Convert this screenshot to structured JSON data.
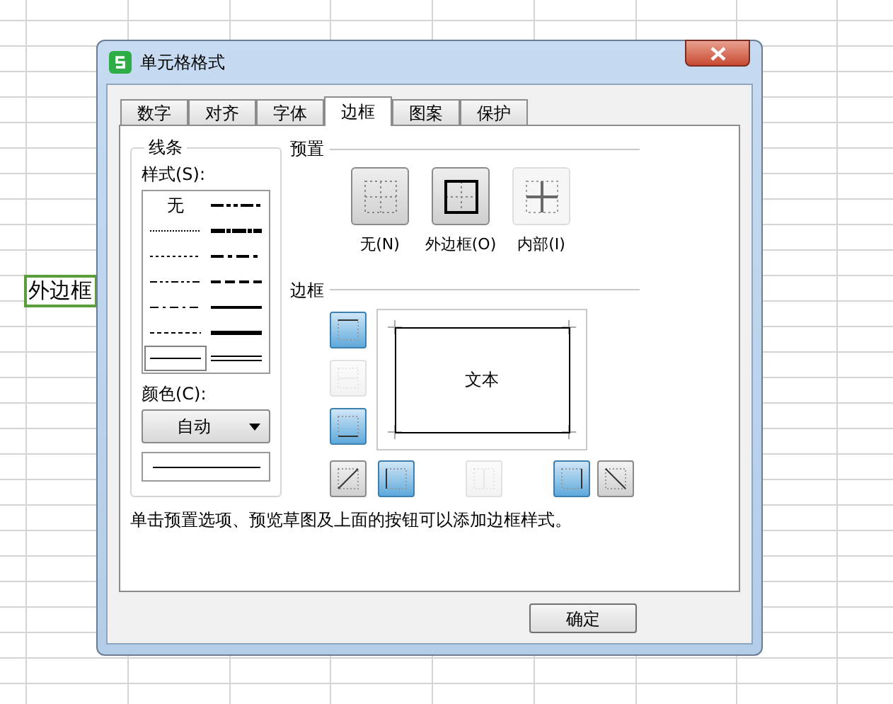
{
  "sheet": {
    "cell_text": "外边框"
  },
  "window": {
    "title": "单元格格式"
  },
  "tabs": [
    {
      "label": "数字",
      "selected": false
    },
    {
      "label": "对齐",
      "selected": false
    },
    {
      "label": "字体",
      "selected": false
    },
    {
      "label": "边框",
      "selected": true
    },
    {
      "label": "图案",
      "selected": false
    },
    {
      "label": "保护",
      "selected": false
    }
  ],
  "line_group": {
    "title": "线条",
    "style_label": "样式(S):",
    "color_label": "颜色(C):",
    "color_value": "自动"
  },
  "line_styles": [
    {
      "kind": "none",
      "label": "无",
      "selected": false
    },
    {
      "kind": "medium-dash-dot-dot",
      "selected": false
    },
    {
      "kind": "hair",
      "selected": false
    },
    {
      "kind": "slant-dash-dot",
      "selected": false
    },
    {
      "kind": "dotted",
      "selected": false
    },
    {
      "kind": "medium-dash-dot",
      "selected": false
    },
    {
      "kind": "dash-dot-dot",
      "selected": false
    },
    {
      "kind": "medium-dashed",
      "selected": false
    },
    {
      "kind": "dash-dot",
      "selected": false
    },
    {
      "kind": "medium",
      "selected": false
    },
    {
      "kind": "dashed",
      "selected": false
    },
    {
      "kind": "thick",
      "selected": false
    },
    {
      "kind": "thin",
      "selected": true
    },
    {
      "kind": "double",
      "selected": false
    }
  ],
  "presets": {
    "title": "预置",
    "items": [
      {
        "kind": "none",
        "label": "无(N)",
        "disabled": false
      },
      {
        "kind": "outline",
        "label": "外边框(O)",
        "disabled": false
      },
      {
        "kind": "inside",
        "label": "内部(I)",
        "disabled": true
      }
    ]
  },
  "border": {
    "title": "边框",
    "preview_text": "文本",
    "side_buttons": [
      {
        "kind": "top",
        "selected": true,
        "disabled": false
      },
      {
        "kind": "middle",
        "selected": false,
        "disabled": true
      },
      {
        "kind": "bottom",
        "selected": true,
        "disabled": false
      }
    ],
    "bottom_buttons": [
      {
        "kind": "diagonal-up",
        "selected": false,
        "disabled": false
      },
      {
        "kind": "left",
        "selected": true,
        "disabled": false
      },
      {
        "kind": "center",
        "selected": false,
        "disabled": true
      },
      {
        "kind": "right",
        "selected": true,
        "disabled": false
      },
      {
        "kind": "diagonal-down",
        "selected": false,
        "disabled": false
      }
    ]
  },
  "note": "单击预置选项、预览草图及上面的按钮可以添加边框样式。",
  "buttons": [
    "确定"
  ]
}
